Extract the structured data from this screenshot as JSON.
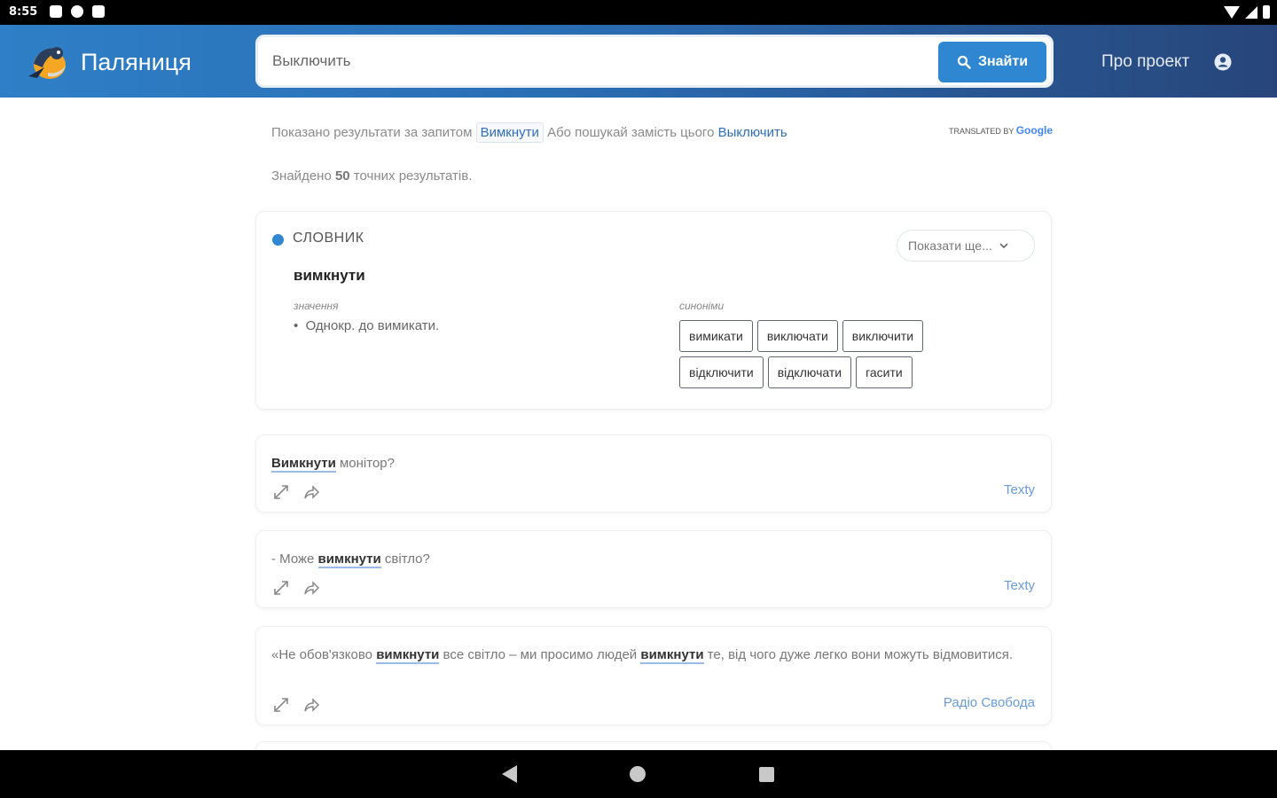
{
  "status_bar": {
    "time": "8:55"
  },
  "header": {
    "brand": "Паляниця",
    "search": {
      "value": "",
      "placeholder": "Выключить",
      "button_label": "Знайти"
    },
    "about_link": "Про проект"
  },
  "results": {
    "shown_prefix": "Показано результати за запитом",
    "corrected_query": "Вимкнути",
    "alt_prefix": "Або пошукай замість цього",
    "alt_query": "Выключить",
    "powered_by": "TRANSLATED BY",
    "powered_brand": "Google",
    "found_prefix": "Знайдено",
    "found_count": "50",
    "found_suffix": "точних результатів."
  },
  "dictionary": {
    "section_label": "СЛОВНИК",
    "more_label": "Показати ще...",
    "headword": "вимкнути",
    "meaning_label": "значення",
    "meaning": "Однокр. до вимикати.",
    "synonyms_label": "синоніми",
    "synonyms": [
      "вимикати",
      "виключати",
      "виключити",
      "відключити",
      "відключати",
      "гасити"
    ]
  },
  "examples": [
    {
      "highlight": "Вимкнути",
      "after": " монітор?",
      "source": "Texty"
    },
    {
      "before": "- Може ",
      "highlight": "вимкнути",
      "after": " світло?",
      "source": "Texty"
    },
    {
      "before": "«Не обов'язково ",
      "highlight": "вимкнути",
      "middle": " все світло – ми просимо людей ",
      "highlight2": "вимкнути",
      "after": " те, від чого дуже легко вони можуть відмовитися.",
      "source": "Радіо Свобода"
    }
  ],
  "colors": {
    "accent": "#2f87d1",
    "header_start": "#2e7fc7",
    "header_end": "#27457a",
    "link": "#2f6fb8"
  }
}
